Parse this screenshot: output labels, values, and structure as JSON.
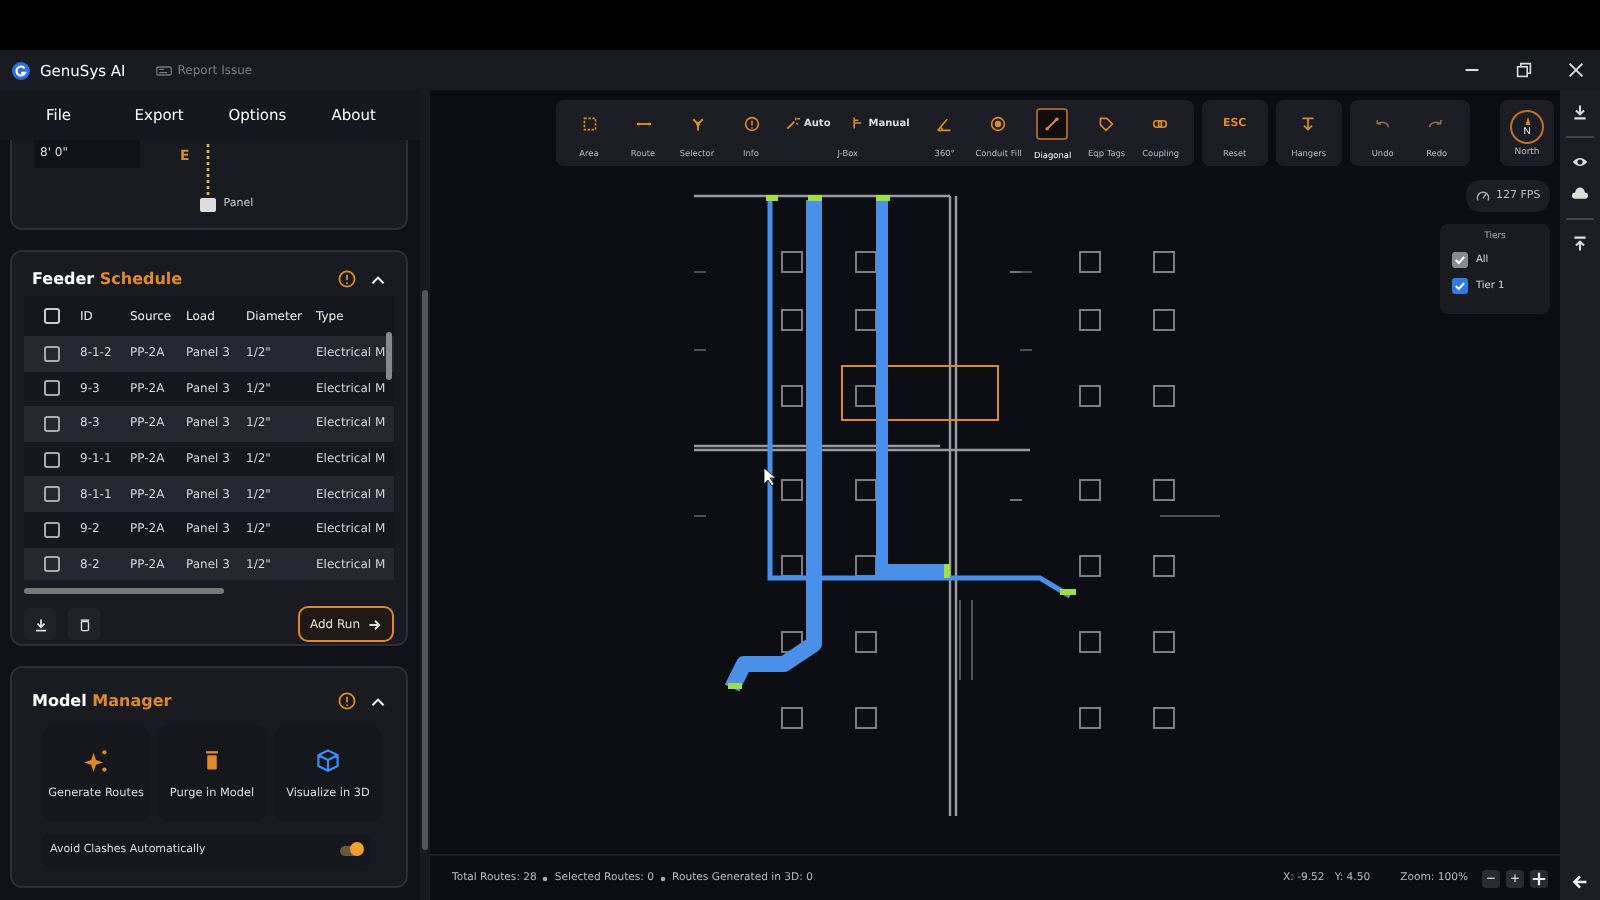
{
  "titlebar": {
    "app_title": "GenuSys AI",
    "report_link": "Report Issue"
  },
  "menu": [
    "File",
    "Export",
    "Options",
    "About"
  ],
  "riser_card": {
    "value": "8' 0\"",
    "marker": "E",
    "label": "Panel"
  },
  "feeder": {
    "title": "Feeder",
    "title_accent": "Schedule",
    "expanded": true,
    "all_checked": false,
    "columns": [
      "ID",
      "Source",
      "Load",
      "Diameter",
      "Type"
    ],
    "rows": [
      {
        "checked": false,
        "cells": [
          "8-1-2",
          "PP-2A",
          "Panel 3",
          "1/2\"",
          "Electrical M"
        ]
      },
      {
        "checked": false,
        "cells": [
          "9-3",
          "PP-2A",
          "Panel 3",
          "1/2\"",
          "Electrical M"
        ]
      },
      {
        "checked": false,
        "cells": [
          "8-3",
          "PP-2A",
          "Panel 3",
          "1/2\"",
          "Electrical M"
        ]
      },
      {
        "checked": false,
        "cells": [
          "9-1-1",
          "PP-2A",
          "Panel 3",
          "1/2\"",
          "Electrical M"
        ]
      },
      {
        "checked": false,
        "cells": [
          "8-1-1",
          "PP-2A",
          "Panel 3",
          "1/2\"",
          "Electrical M"
        ]
      },
      {
        "checked": false,
        "cells": [
          "9-2",
          "PP-2A",
          "Panel 3",
          "1/2\"",
          "Electrical M"
        ]
      },
      {
        "checked": false,
        "cells": [
          "8-2",
          "PP-2A",
          "Panel 3",
          "1/2\"",
          "Electrical M"
        ]
      }
    ],
    "add_button": "Add Run"
  },
  "model_manager": {
    "title": "Model",
    "title_accent": "Manager",
    "expanded": true,
    "actions": [
      "Generate Routes",
      "Purge in Model",
      "Visualize in 3D"
    ],
    "toggle": {
      "label": "Avoid Clashes Automatically",
      "on": true
    }
  },
  "toolbar": {
    "groups": [
      {
        "items": [
          {
            "kind": "tool",
            "label": "Area",
            "selected": false
          },
          {
            "kind": "tool",
            "label": "Route",
            "selected": false
          },
          {
            "kind": "tool",
            "label": "Selector",
            "selected": false
          },
          {
            "kind": "tool",
            "label": "Info",
            "selected": false
          },
          {
            "kind": "jbox",
            "label": "J-Box",
            "options": [
              {
                "label": "Auto",
                "selected": false
              },
              {
                "label": "Manual",
                "selected": false
              }
            ]
          },
          {
            "kind": "tool",
            "label": "360°",
            "selected": false
          },
          {
            "kind": "tool",
            "label": "Conduit Fill",
            "selected": false
          },
          {
            "kind": "tool",
            "label": "Diagonal",
            "selected": true
          },
          {
            "kind": "tool",
            "label": "Eqp Tags",
            "selected": false
          },
          {
            "kind": "tool",
            "label": "Coupling",
            "selected": false
          }
        ]
      },
      {
        "items": [
          {
            "kind": "key",
            "key": "ESC",
            "label": "Reset",
            "selected": false
          }
        ]
      },
      {
        "items": [
          {
            "kind": "tool",
            "label": "Hangers",
            "selected": false
          }
        ]
      },
      {
        "items": [
          {
            "kind": "tool",
            "label": "Undo",
            "selected": false
          },
          {
            "kind": "tool",
            "label": "Redo",
            "selected": false
          }
        ]
      }
    ]
  },
  "compass": {
    "letter": "N",
    "label": "North"
  },
  "fps": "127 FPS",
  "tiers": {
    "title": "Tiers",
    "items": [
      {
        "kind": "master",
        "label": "All",
        "checked": true
      },
      {
        "kind": "tier",
        "label": "Tier 1",
        "checked": true
      }
    ]
  },
  "status_bar": {
    "stats": [
      "Total Routes: 28",
      "Selected Routes: 0",
      "Routes Generated in 3D: 0"
    ],
    "x": "X: -9.52",
    "y": "Y: 4.50",
    "zoom": "Zoom: 100%",
    "zoom_out": "−",
    "zoom_in": "+"
  }
}
